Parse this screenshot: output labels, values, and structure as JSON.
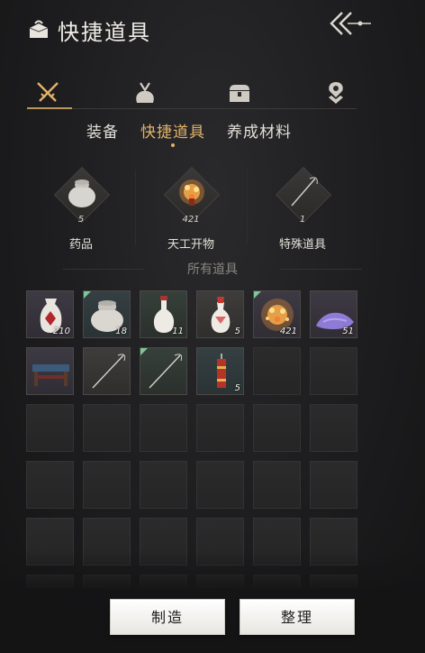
{
  "header": {
    "title": "快捷道具",
    "title_icon": "bag-icon",
    "back_icon": "double-chevron-left-icon"
  },
  "category_tabs": [
    {
      "icon": "crossed-swords-icon",
      "active": true
    },
    {
      "icon": "pouch-icon",
      "active": false
    },
    {
      "icon": "chest-icon",
      "active": false
    },
    {
      "icon": "location-pin-icon",
      "active": false
    }
  ],
  "subtabs": [
    {
      "label": "装备",
      "active": false
    },
    {
      "label": "快捷道具",
      "active": true
    },
    {
      "label": "养成材料",
      "active": false
    }
  ],
  "summary": [
    {
      "label": "药品",
      "count": "5",
      "icon": "jar-icon"
    },
    {
      "label": "天工开物",
      "count": "421",
      "icon": "firecracker-icon"
    },
    {
      "label": "特殊道具",
      "count": "1",
      "icon": "needle-icon"
    }
  ],
  "section_title": "所有道具",
  "items": [
    {
      "icon": "red-vase-icon",
      "count": "210",
      "rarity": "purple",
      "new": false
    },
    {
      "icon": "white-jar-icon",
      "count": "18",
      "rarity": "teal",
      "new": true
    },
    {
      "icon": "white-bottle-icon",
      "count": "11",
      "rarity": "green",
      "new": false
    },
    {
      "icon": "red-cap-bottle-icon",
      "count": "5",
      "rarity": "filled",
      "new": false
    },
    {
      "icon": "firecracker-icon",
      "count": "421",
      "rarity": "purple",
      "new": true
    },
    {
      "icon": "purple-powder-icon",
      "count": "51",
      "rarity": "purple",
      "new": false
    },
    {
      "icon": "table-icon",
      "count": "",
      "rarity": "purple",
      "new": false
    },
    {
      "icon": "needle-icon",
      "count": "",
      "rarity": "filled",
      "new": false
    },
    {
      "icon": "needle-icon",
      "count": "",
      "rarity": "green",
      "new": true
    },
    {
      "icon": "red-candle-icon",
      "count": "5",
      "rarity": "teal",
      "new": false
    }
  ],
  "buttons": {
    "craft": "制造",
    "sort": "整理"
  },
  "colors": {
    "accent": "#e2b36a",
    "new_marker": "#7ec59a"
  }
}
